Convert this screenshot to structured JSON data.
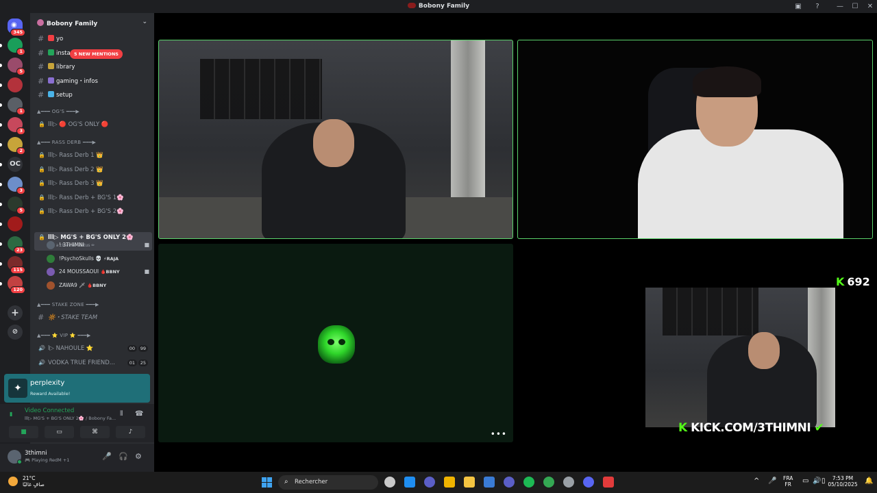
{
  "window": {
    "title": "Bobony Family",
    "inbox_icon": "inbox-icon",
    "help_icon": "help-icon",
    "minimize": "—",
    "maximize": "☐",
    "close": "✕"
  },
  "rail": {
    "home_badge": "345",
    "servers": [
      {
        "badge": "1",
        "color": "#1a9e5a"
      },
      {
        "badge": "5",
        "color": "#9a4b6b"
      },
      {
        "badge": "",
        "color": "#b3323b"
      },
      {
        "badge": "1",
        "color": "#5a5f66"
      },
      {
        "badge": "3",
        "color": "#c7485c"
      },
      {
        "badge": "2",
        "color": "#c7a43a"
      },
      {
        "badge": "",
        "color": "#313338",
        "text": "OC"
      },
      {
        "badge": "3",
        "color": "#6d8ec9"
      },
      {
        "badge": "5",
        "color": "#2b3a2d"
      },
      {
        "badge": "",
        "color": "#a11b1b"
      },
      {
        "badge": "23",
        "color": "#2c6a42"
      },
      {
        "badge": "115",
        "color": "#7b2b2b"
      },
      {
        "badge": "120",
        "color": "#c24141"
      }
    ],
    "add_server": "+",
    "discover": "⊘"
  },
  "sidebar": {
    "guild_name": "Bobony Family",
    "mention_pill": "5 NEW MENTIONS",
    "text_channels": [
      {
        "name": "yo",
        "emoji_color": "#f23f43"
      },
      {
        "name": "instagram",
        "emoji_color": "#23a55a"
      },
      {
        "name": "library",
        "emoji_color": "#c7a43a"
      },
      {
        "name": "gaming・infos",
        "emoji_color": "#8a6fd1"
      },
      {
        "name": "setup",
        "emoji_color": "#4ab3e8"
      }
    ],
    "cat_ogs": "▲━━━ OG'S ━━━▶",
    "og_only": "lll▷ 🔴 OG'S ONLY 🔴",
    "cat_rass": "▲━━━ RASS DERB ━━━▶",
    "rass_channels": [
      "lll▷ Rass Derb 1 👑",
      "lll▷ Rass Derb 2 👑",
      "lll▷ Rass Derb 3 👑",
      "lll▷ Rass Derb + BG'S 1🌸",
      "lll▷ Rass Derb + BG'S 2🌸"
    ],
    "active_channel": "lll▷ MG'S + BG'S ONLY 2🌸",
    "active_status": "Set a channel status ✏",
    "voice_users": [
      {
        "name": "! 3THIMNI",
        "tag": "",
        "cam": true,
        "color": "#5a6470"
      },
      {
        "name": "!PsychoSkulls 💀",
        "tag": "⚡RAJA",
        "cam": false,
        "color": "#2f7d3a"
      },
      {
        "name": "24 MOUSSAOUI",
        "tag": "🩸BBNY",
        "cam": true,
        "color": "#7a5bb0"
      },
      {
        "name": "ZAWA9 🗡",
        "tag": "🩸BBNY",
        "cam": false,
        "color": "#a0522d"
      }
    ],
    "cat_stake": "▲━━━ STAKE ZONE ━━━▶",
    "stake_team": "🔆・STAKE TEAM",
    "cat_vip": "▲━━━ ⭐ VIP ⭐ ━━━▶",
    "vip_channels": [
      {
        "name": "l▷ NAHOULE ⭐",
        "a": "00",
        "b": "99"
      },
      {
        "name": "VODKA TRUE FRIEND...",
        "a": "01",
        "b": "25"
      }
    ]
  },
  "perplexity": {
    "title": "perplexity",
    "subtitle": "Reward Available!"
  },
  "voice_panel": {
    "status": "Video Connected",
    "location": "lll▷ MG'S + BG'S ONLY 2🌸 / Bobony Fa...",
    "buttons": [
      "camera-icon",
      "screen-share-icon",
      "activity-icon",
      "soundboard-icon"
    ]
  },
  "user_panel": {
    "name": "3thimni",
    "activity": "🎮 Playing RedM +1"
  },
  "stream": {
    "kick_count": "692",
    "kick_url": "KICK.COM/3THIMNI",
    "more": "•••"
  },
  "taskbar": {
    "temp": "21°C",
    "weather": "صافٍ غالبًا",
    "search_placeholder": "Rechercher",
    "lang1": "FRA",
    "lang2": "FR",
    "time": "7:53 PM",
    "date": "05/10/2025",
    "apps": [
      "#c9c9c9",
      "#1f8ef1",
      "#5b5fc7",
      "#f0b400",
      "#f5c542",
      "#3a7bd5",
      "#5b5fc7",
      "#1db954",
      "#34a853",
      "#9aa0a6",
      "#5865f2",
      "#e23b3b"
    ]
  }
}
